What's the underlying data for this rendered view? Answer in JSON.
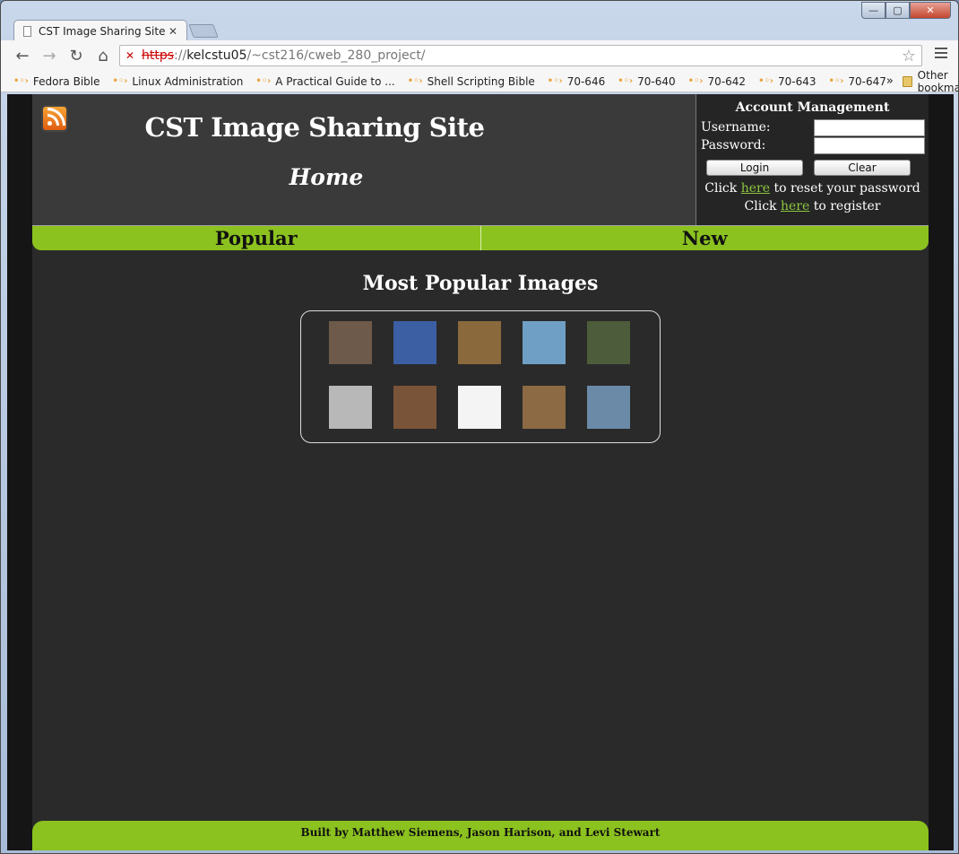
{
  "browser": {
    "tab_title": "CST Image Sharing Site",
    "tab_close": "✕",
    "url_scheme": "https",
    "url_sep": "://",
    "url_host": "kelcstu05",
    "url_path": "/~cst216/cweb_280_project/",
    "win_min": "—",
    "win_max": "▢",
    "win_close": "✕",
    "back": "←",
    "forward": "→",
    "reload": "↻",
    "home": "⌂",
    "star": "☆",
    "bookmarks": [
      "Fedora Bible",
      "Linux Administration",
      "A Practical Guide to ...",
      "Shell Scripting Bible",
      "70-646",
      "70-640",
      "70-642",
      "70-643",
      "70-647"
    ],
    "bookmarks_more": "»",
    "other_bookmarks": "Other bookmarks"
  },
  "site": {
    "title": "CST Image Sharing Site",
    "page": "Home",
    "nav": {
      "popular": "Popular",
      "new": "New"
    },
    "section_title": "Most Popular Images",
    "footer": "Built by Matthew Siemens, Jason Harison, and Levi Stewart"
  },
  "account": {
    "title": "Account Management",
    "username_label": "Username:",
    "password_label": "Password:",
    "login_button": "Login",
    "clear_button": "Clear",
    "reset_prefix": "Click",
    "reset_link": "here",
    "reset_suffix": "to reset your password",
    "register_prefix": "Click",
    "register_link": "here",
    "register_suffix": "to register"
  },
  "gallery": {
    "thumbnails": [
      {
        "name": "image-thumbnail-1",
        "color": "#6e5a4a"
      },
      {
        "name": "image-thumbnail-2",
        "color": "#3c5ea2"
      },
      {
        "name": "image-thumbnail-3",
        "color": "#8a6a3c"
      },
      {
        "name": "image-thumbnail-4",
        "color": "#6f9fc4"
      },
      {
        "name": "image-thumbnail-5",
        "color": "#4d5c3a"
      },
      {
        "name": "image-thumbnail-6",
        "color": "#b8b8b8"
      },
      {
        "name": "image-thumbnail-7",
        "color": "#7a5438"
      },
      {
        "name": "image-thumbnail-8",
        "color": "#f4f4f4"
      },
      {
        "name": "image-thumbnail-9",
        "color": "#8c6a44"
      },
      {
        "name": "image-thumbnail-10",
        "color": "#6b8aa8"
      }
    ]
  }
}
